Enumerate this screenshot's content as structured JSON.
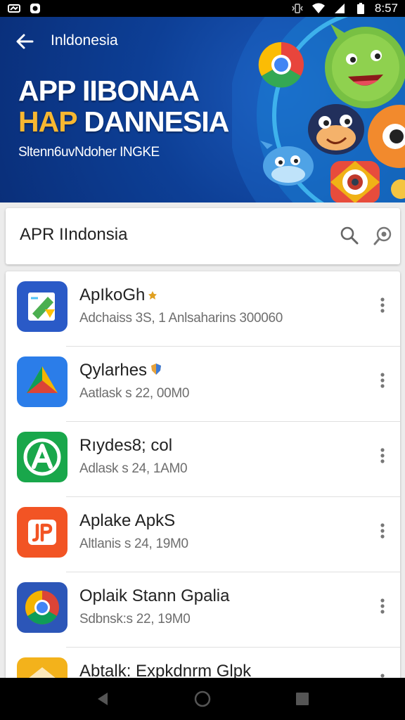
{
  "status_bar": {
    "time": "8:57",
    "left_icons": [
      "notification-icon",
      "message-icon"
    ],
    "right_icons": [
      "vibrate-icon",
      "wifi-icon",
      "signal-icon",
      "battery-icon"
    ]
  },
  "banner": {
    "back_icon": "arrow-left-icon",
    "title": "Inldonesia",
    "headline_line1": "APP IIBONAA",
    "headline_line2_accent": "HAP",
    "headline_line2_rest": " DANNESIA",
    "subtitle": "Sltenn6uvNdoher INGKE"
  },
  "search": {
    "text": "APR IIndonsia",
    "icons": [
      "search-icon",
      "voice-search-icon"
    ]
  },
  "apps": [
    {
      "name": "ApIkoGh",
      "meta": "Adchaiss 3S, 1 Anlsaharins 300060",
      "icon": "aplikogh-app-icon",
      "badge": "star-badge-icon"
    },
    {
      "name": "Qylarhes",
      "meta": "Aatlask s 22, 00M0",
      "icon": "qylarhes-app-icon",
      "badge": "shield-badge-icon"
    },
    {
      "name": "Rıydes8; col",
      "meta": "Adlask s 24, 1AM0",
      "icon": "riydes-app-icon"
    },
    {
      "name": "Aplake ApkS",
      "meta": "Altlanis s 24, 19M0",
      "icon": "aplake-app-icon"
    },
    {
      "name": "Oplaik Stann Gpalia",
      "meta": "Sdbnsk:s 22, 19M0",
      "icon": "chrome-app-icon"
    },
    {
      "name": "Abtalk: Expkdnrm Glpk",
      "meta": "",
      "icon": "abtalk-app-icon"
    }
  ],
  "nav_bar": {
    "buttons": [
      "back-nav-icon",
      "home-nav-icon",
      "recents-nav-icon"
    ]
  },
  "colors": {
    "banner_blue": "#0d3f96",
    "accent_yellow": "#f7b731",
    "text_primary": "#222222",
    "text_secondary": "#6e6e6e"
  }
}
